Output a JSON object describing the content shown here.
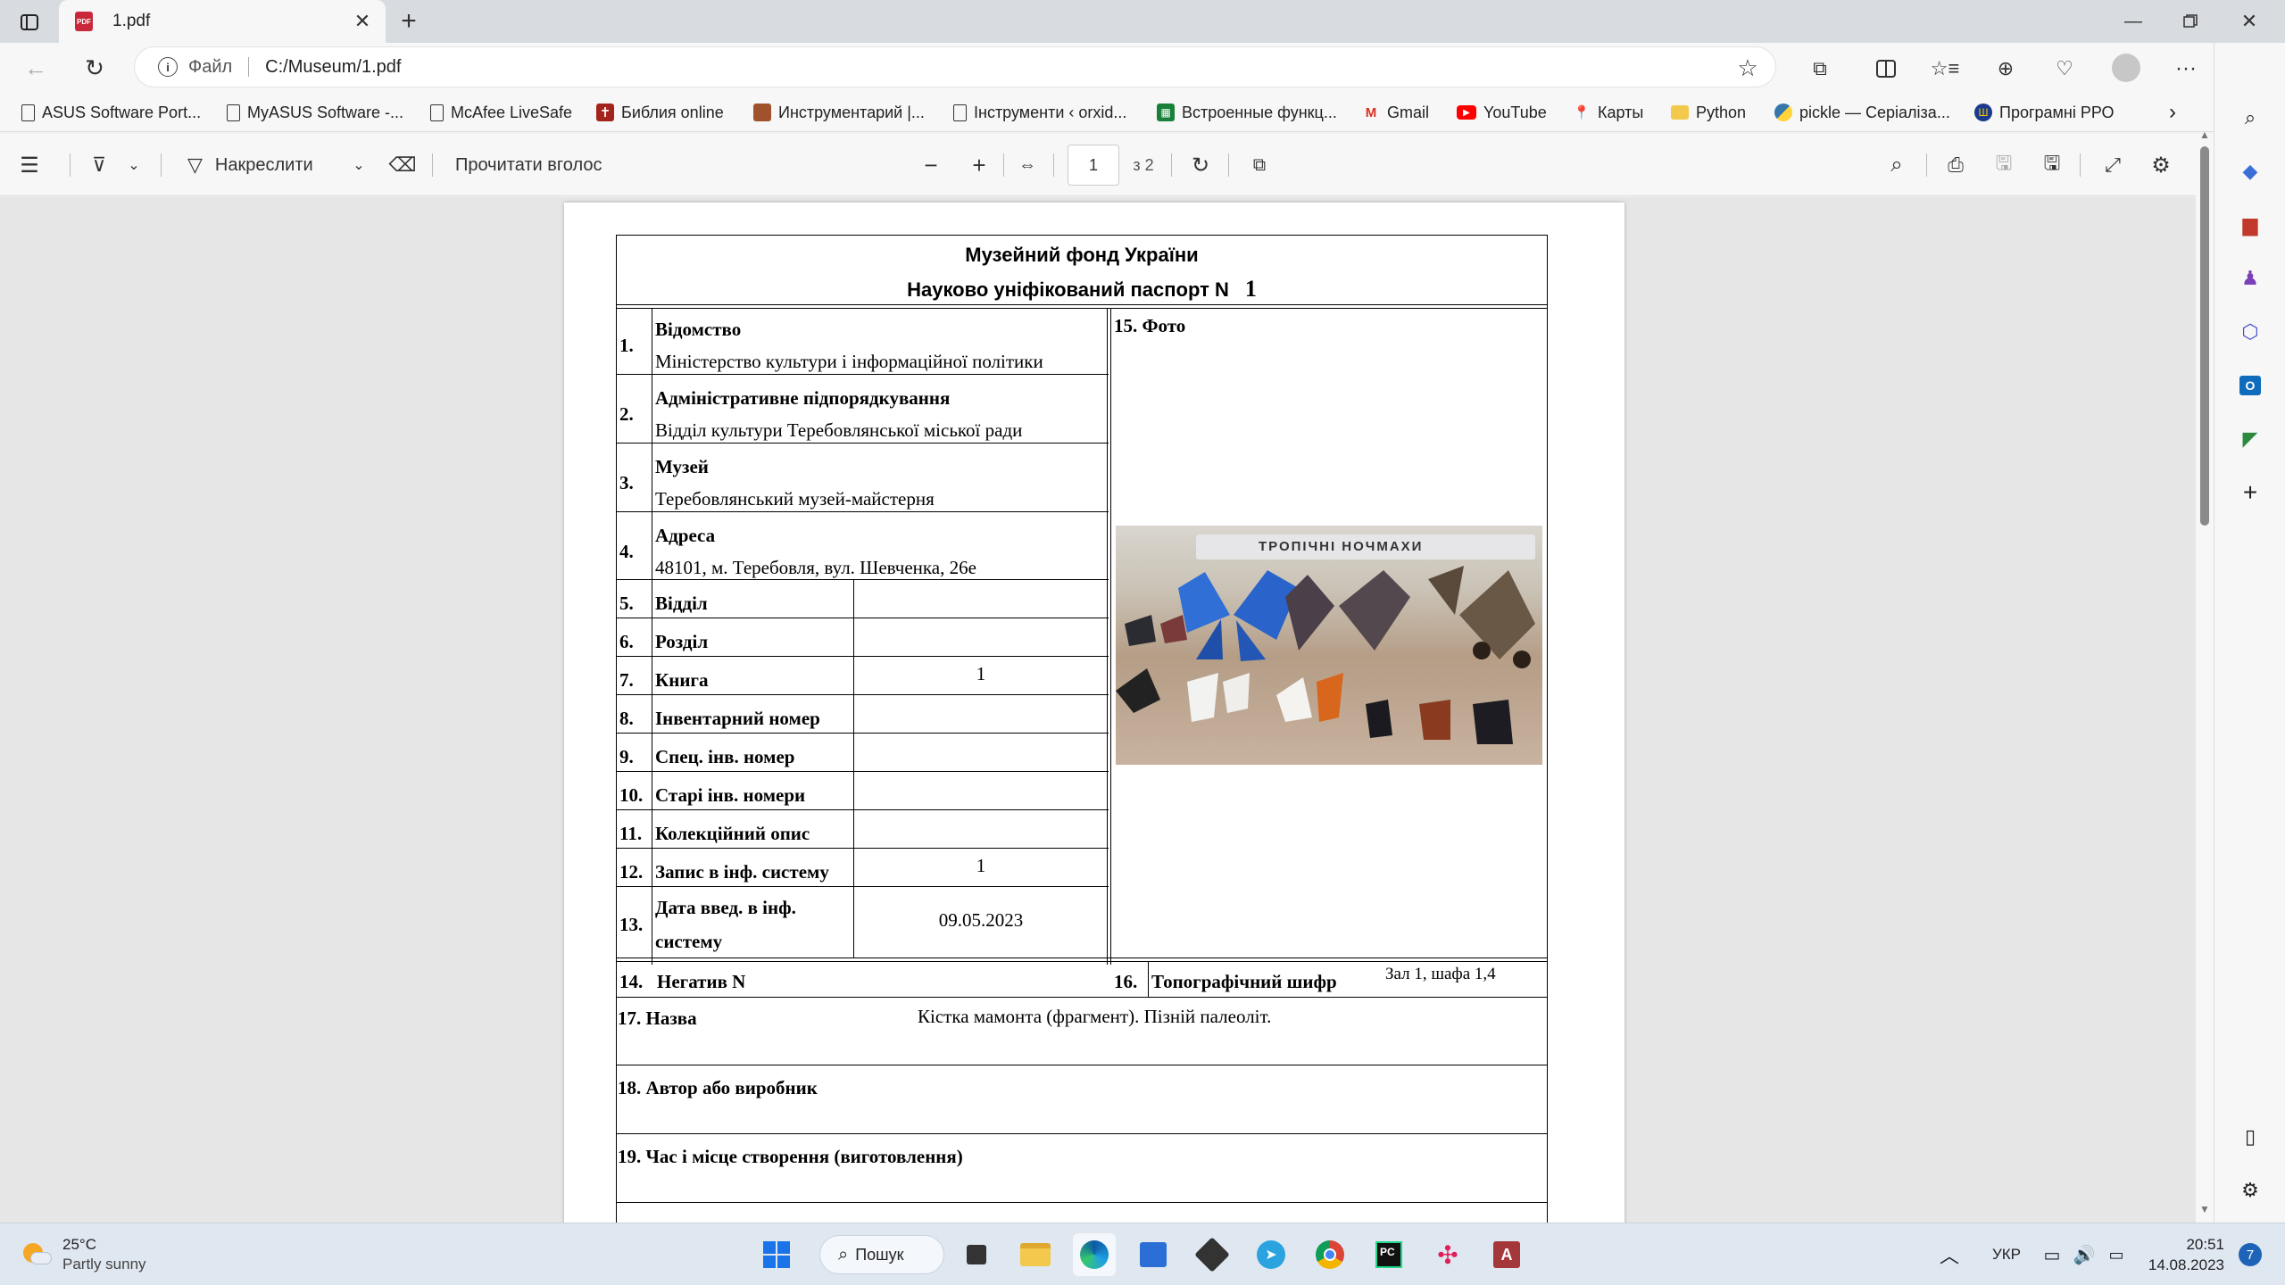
{
  "browser": {
    "tab_title": "1.pdf",
    "address_label": "Файл",
    "address_url": "C:/Museum/1.pdf"
  },
  "favorites": [
    {
      "label": "ASUS Software Port...",
      "icon": "page-icon"
    },
    {
      "label": "MyASUS Software -...",
      "icon": "page-icon"
    },
    {
      "label": "McAfee LiveSafe",
      "icon": "page-icon"
    },
    {
      "label": "Библия online",
      "icon": "bible-icon"
    },
    {
      "label": "Инструментарий |...",
      "icon": "tools-icon"
    },
    {
      "label": "Інструменти ‹ orxid...",
      "icon": "page-icon"
    },
    {
      "label": "Встроенные функц...",
      "icon": "sheet-icon"
    },
    {
      "label": "Gmail",
      "icon": "gmail-icon"
    },
    {
      "label": "YouTube",
      "icon": "youtube-icon"
    },
    {
      "label": "Карты",
      "icon": "maps-icon"
    },
    {
      "label": "Python",
      "icon": "folder-icon"
    },
    {
      "label": "pickle — Серіаліза...",
      "icon": "python-icon"
    },
    {
      "label": "Програмні РРО",
      "icon": "emblem-icon"
    }
  ],
  "pdf_toolbar": {
    "draw_label": "Накреслити",
    "read_aloud_label": "Прочитати вголос",
    "page_current": "1",
    "page_total": "з 2"
  },
  "document": {
    "header_line1": "Музейний фонд України",
    "header_line2": "Науково уніфікований паспорт N",
    "passport_number": "1",
    "photo_label": "15. Фото",
    "photo_sign_text": "ТРОПІЧНІ НОЧМАХИ",
    "rows": [
      {
        "num": "1.",
        "label": "Відомство",
        "value": "Міністерство культури і інформаційної політики"
      },
      {
        "num": "2.",
        "label": "Адміністративне підпорядкування",
        "value": "Відділ культури Теребовлянської міської ради"
      },
      {
        "num": "3.",
        "label": "Музей",
        "value": "Теребовлянський музей-майстерня"
      },
      {
        "num": "4.",
        "label": "Адреса",
        "value": "48101, м. Теребовля, вул. Шевченка, 26е"
      }
    ],
    "fields": [
      {
        "num": "5.",
        "label": "Відділ",
        "value": ""
      },
      {
        "num": "6.",
        "label": "Розділ",
        "value": ""
      },
      {
        "num": "7.",
        "label": "Книга",
        "value": "1"
      },
      {
        "num": "8.",
        "label": "Інвентарний номер",
        "value": ""
      },
      {
        "num": "9.",
        "label": "Спец. інв. номер",
        "value": ""
      },
      {
        "num": "10.",
        "label": "Старі інв. номери",
        "value": ""
      },
      {
        "num": "11.",
        "label": "Колекційний опис",
        "value": ""
      },
      {
        "num": "12.",
        "label": "Запис в інф. систему",
        "value": "1"
      }
    ],
    "field13": {
      "num": "13.",
      "label_l1": "Дата введ. в інф.",
      "label_l2": "системy",
      "value": "09.05.2023"
    },
    "field14": {
      "num": "14.",
      "label": "Негатив N"
    },
    "field16": {
      "num": "16.",
      "label": "Топографічний шифр",
      "value": "Зал 1, шафа 1,4"
    },
    "field17": {
      "label": "17. Назва",
      "value": "Кістка мамонта (фрагмент). Пізній палеоліт."
    },
    "field18": {
      "label": "18. Автор або виробник"
    },
    "field19": {
      "label": "19. Час і місце створення (виготовлення)"
    }
  },
  "taskbar": {
    "weather_temp": "25°C",
    "weather_desc": "Partly sunny",
    "search_label": "Пошук",
    "lang": "УКР",
    "time": "20:51",
    "date": "14.08.2023",
    "notif_count": "7"
  }
}
